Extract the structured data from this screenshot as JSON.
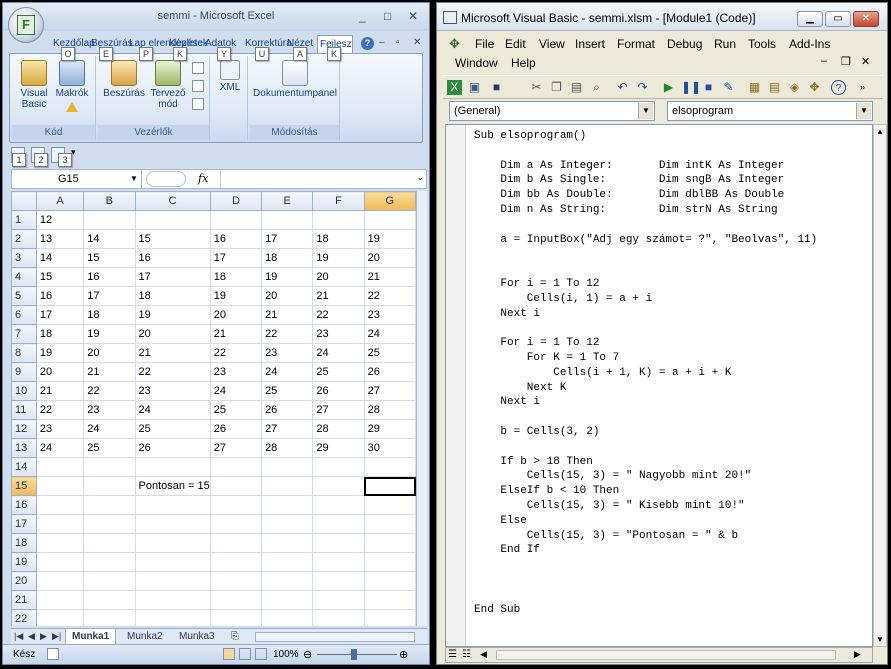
{
  "excel": {
    "title": "semmi - Microsoft Excel",
    "logo_letter": "F",
    "window_buttons": [
      "_",
      "□",
      "✕"
    ],
    "tabs": [
      {
        "label": "Kezdőlap",
        "key": "O"
      },
      {
        "label": "Beszúrás",
        "key": "E"
      },
      {
        "label": "Lap elrendezése",
        "key": "P"
      },
      {
        "label": "Képletek",
        "key": "K"
      },
      {
        "label": "Adatok",
        "key": "Y"
      },
      {
        "label": "Korrektúra",
        "key": "U"
      },
      {
        "label": "Nézet",
        "key": "A"
      },
      {
        "label": "Fejlesztőeszközök",
        "key": "K"
      }
    ],
    "ribbon": {
      "groups": [
        {
          "label": "Kód",
          "buttons": [
            "Visual Basic",
            "Makrók"
          ]
        },
        {
          "label": "Vezérlők",
          "buttons": [
            "Beszúrás",
            "Tervező mód"
          ]
        },
        {
          "label": "",
          "buttons": [
            "XML"
          ]
        },
        {
          "label": "Módosítás",
          "buttons": [
            "Dokumentumpanel"
          ]
        }
      ]
    },
    "qat_keys": [
      "1",
      "2",
      "3"
    ],
    "name_box": "G15",
    "fx_label": "fx",
    "columns": [
      "A",
      "B",
      "C",
      "D",
      "E",
      "F",
      "G"
    ],
    "selected_column": "G",
    "selected_row": 15,
    "rows": [
      {
        "n": "1",
        "cells": [
          "12",
          "",
          "",
          "",
          "",
          "",
          ""
        ]
      },
      {
        "n": "2",
        "cells": [
          "13",
          "14",
          "15",
          "16",
          "17",
          "18",
          "19"
        ]
      },
      {
        "n": "3",
        "cells": [
          "14",
          "15",
          "16",
          "17",
          "18",
          "19",
          "20"
        ]
      },
      {
        "n": "4",
        "cells": [
          "15",
          "16",
          "17",
          "18",
          "19",
          "20",
          "21"
        ]
      },
      {
        "n": "5",
        "cells": [
          "16",
          "17",
          "18",
          "19",
          "20",
          "21",
          "22"
        ]
      },
      {
        "n": "6",
        "cells": [
          "17",
          "18",
          "19",
          "20",
          "21",
          "22",
          "23"
        ]
      },
      {
        "n": "7",
        "cells": [
          "18",
          "19",
          "20",
          "21",
          "22",
          "23",
          "24"
        ]
      },
      {
        "n": "8",
        "cells": [
          "19",
          "20",
          "21",
          "22",
          "23",
          "24",
          "25"
        ]
      },
      {
        "n": "9",
        "cells": [
          "20",
          "21",
          "22",
          "23",
          "24",
          "25",
          "26"
        ]
      },
      {
        "n": "10",
        "cells": [
          "21",
          "22",
          "23",
          "24",
          "25",
          "26",
          "27"
        ]
      },
      {
        "n": "11",
        "cells": [
          "22",
          "23",
          "24",
          "25",
          "26",
          "27",
          "28"
        ]
      },
      {
        "n": "12",
        "cells": [
          "23",
          "24",
          "25",
          "26",
          "27",
          "28",
          "29"
        ]
      },
      {
        "n": "13",
        "cells": [
          "24",
          "25",
          "26",
          "27",
          "28",
          "29",
          "30"
        ]
      },
      {
        "n": "14",
        "cells": [
          "",
          "",
          "",
          "",
          "",
          "",
          ""
        ]
      },
      {
        "n": "15",
        "cells": [
          "",
          "",
          "Pontosan = 15",
          "",
          "",
          "",
          ""
        ]
      },
      {
        "n": "16",
        "cells": [
          "",
          "",
          "",
          "",
          "",
          "",
          ""
        ]
      },
      {
        "n": "17",
        "cells": [
          "",
          "",
          "",
          "",
          "",
          "",
          ""
        ]
      },
      {
        "n": "18",
        "cells": [
          "",
          "",
          "",
          "",
          "",
          "",
          ""
        ]
      },
      {
        "n": "19",
        "cells": [
          "",
          "",
          "",
          "",
          "",
          "",
          ""
        ]
      },
      {
        "n": "20",
        "cells": [
          "",
          "",
          "",
          "",
          "",
          "",
          ""
        ]
      },
      {
        "n": "21",
        "cells": [
          "",
          "",
          "",
          "",
          "",
          "",
          ""
        ]
      },
      {
        "n": "22",
        "cells": [
          "",
          "",
          "",
          "",
          "",
          "",
          ""
        ]
      }
    ],
    "sheet_tabs": [
      "Munka1",
      "Munka2",
      "Munka3"
    ],
    "active_sheet": "Munka1",
    "status": {
      "ready": "Kész",
      "zoom": "100%"
    }
  },
  "vba": {
    "title": "Microsoft Visual Basic - semmi.xlsm - [Module1 (Code)]",
    "menu": [
      "File",
      "Edit",
      "View",
      "Insert",
      "Format",
      "Debug",
      "Run",
      "Tools",
      "Add-Ins",
      "Window",
      "Help"
    ],
    "object_combo": "(General)",
    "procedure_combo": "elsoprogram",
    "code": [
      "Sub elsoprogram()",
      "",
      "    Dim a As Integer:       Dim intK As Integer",
      "    Dim b As Single:        Dim sngB As Integer",
      "    Dim bb As Double:       Dim dblBB As Double",
      "    Dim n As String:        Dim strN As String",
      "",
      "    a = InputBox(\"Adj egy számot= ?\", \"Beolvas\", 11)",
      "",
      "",
      "    For i = 1 To 12",
      "        Cells(i, 1) = a + i",
      "    Next i",
      "",
      "    For i = 1 To 12",
      "        For K = 1 To 7",
      "            Cells(i + 1, K) = a + i + K",
      "        Next K",
      "    Next i",
      "",
      "    b = Cells(3, 2)",
      "",
      "    If b > 18 Then",
      "        Cells(15, 3) = \" Nagyobb mint 20!\"",
      "    ElseIf b < 10 Then",
      "        Cells(15, 3) = \" Kisebb mint 10!\"",
      "    Else",
      "        Cells(15, 3) = \"Pontosan = \" & b",
      "    End If",
      "",
      "",
      "",
      "End Sub"
    ]
  }
}
